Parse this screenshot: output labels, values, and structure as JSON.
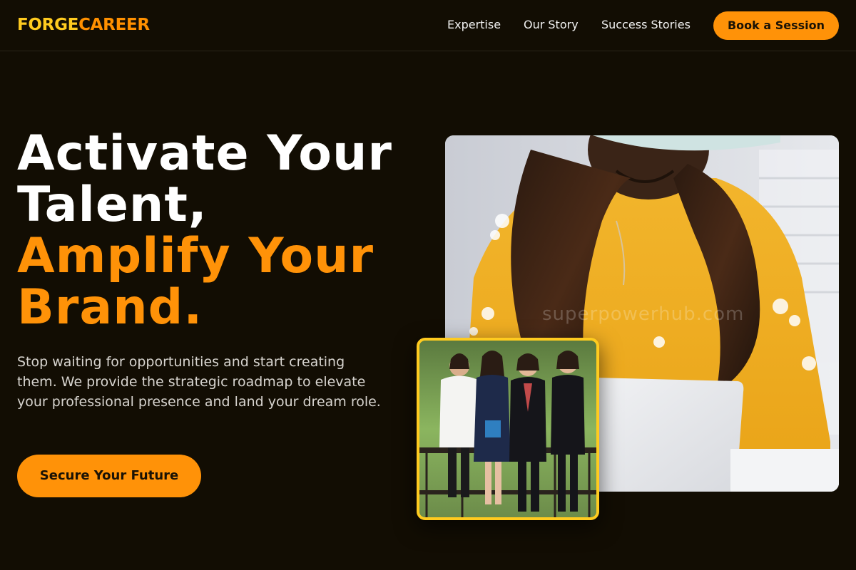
{
  "brand": {
    "part1": "FORGE",
    "part2": "CAREER",
    "color_primary": "#ffcb1f",
    "color_accent": "#ff9000"
  },
  "nav": {
    "items": [
      {
        "label": "Expertise"
      },
      {
        "label": "Our Story"
      },
      {
        "label": "Success Stories"
      }
    ],
    "cta_label": "Book a Session"
  },
  "hero": {
    "headline_line1": "Activate Your",
    "headline_line2": "Talent,",
    "headline_line3": "Amplify Your",
    "headline_line4": "Brand.",
    "subtitle": "Stop waiting for opportunities and start creating them. We provide the strategic roadmap to elevate your professional presence and land your dream role.",
    "cta_label": "Secure Your Future"
  },
  "images": {
    "main_watermark": "superpowerhub.com"
  },
  "theme": {
    "background": "#120d03",
    "accent": "#ff9208",
    "highlight": "#ffcb1f"
  }
}
